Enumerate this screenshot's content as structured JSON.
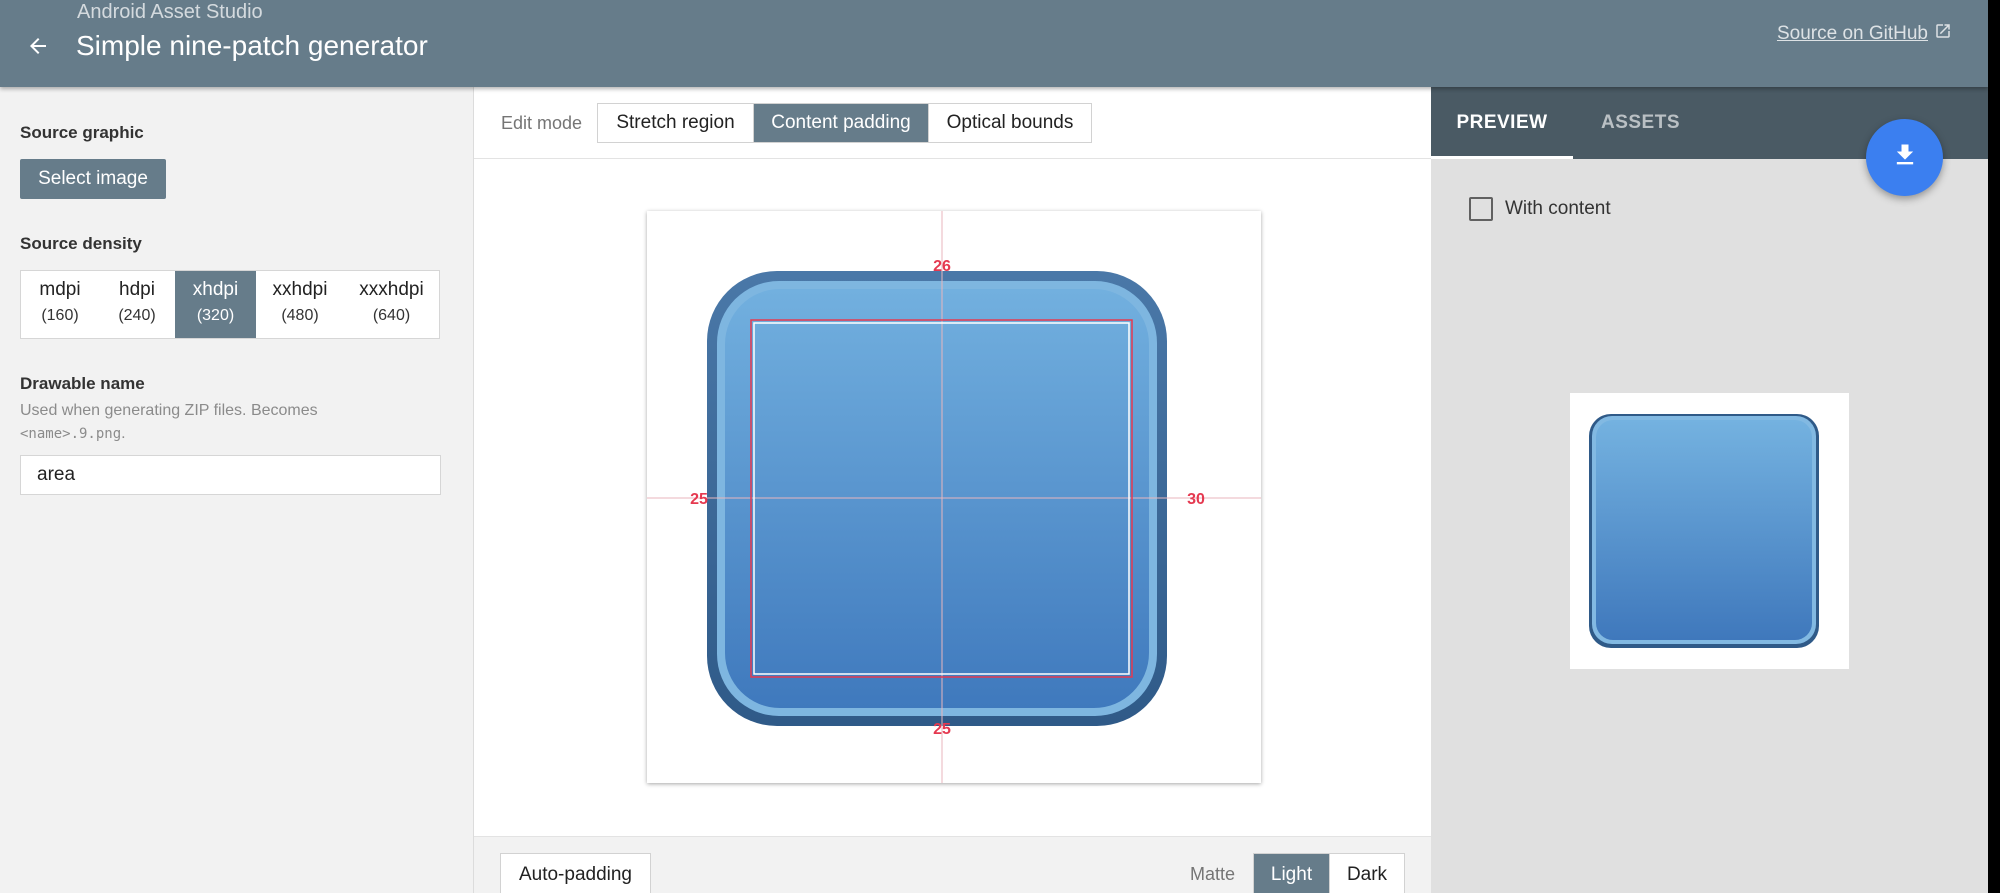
{
  "header": {
    "overline": "Android Asset Studio",
    "title": "Simple nine-patch generator",
    "github_link": "Source on GitHub",
    "back_icon": "arrow-left-icon",
    "external_icon": "open-in-new-icon"
  },
  "sidebar": {
    "source_graphic_label": "Source graphic",
    "select_image_label": "Select image",
    "source_density_label": "Source density",
    "densities": [
      {
        "name": "mdpi",
        "dpi": "(160)"
      },
      {
        "name": "hdpi",
        "dpi": "(240)"
      },
      {
        "name": "xhdpi",
        "dpi": "(320)"
      },
      {
        "name": "xxhdpi",
        "dpi": "(480)"
      },
      {
        "name": "xxxhdpi",
        "dpi": "(640)"
      }
    ],
    "selected_density": "xhdpi",
    "drawable_name_label": "Drawable name",
    "drawable_hint_text": "Used when generating ZIP files. Becomes",
    "drawable_hint_code": "<name>.9.png",
    "drawable_hint_suffix": ".",
    "drawable_name_value": "area"
  },
  "editor": {
    "edit_mode_label": "Edit mode",
    "modes": [
      "Stretch region",
      "Content padding",
      "Optical bounds"
    ],
    "selected_mode": "Content padding",
    "padding": {
      "top": "26",
      "left": "25",
      "right": "30",
      "bottom": "25"
    },
    "auto_padding_label": "Auto-padding",
    "matte_label": "Matte",
    "matte_options": [
      "Light",
      "Dark"
    ],
    "selected_matte": "Light"
  },
  "preview": {
    "tabs": [
      "PREVIEW",
      "ASSETS"
    ],
    "active_tab": "PREVIEW",
    "with_content_label": "With content",
    "with_content_checked": false,
    "download_icon": "download-icon"
  },
  "colors": {
    "header": "#667c8a",
    "selected": "#667c8a",
    "tab_bar": "#4a5a64",
    "fab": "#3b7ff0",
    "padding_marker": "#e53950",
    "button_gradient_top": "#6fafdf",
    "button_gradient_bottom": "#3f78bc"
  }
}
